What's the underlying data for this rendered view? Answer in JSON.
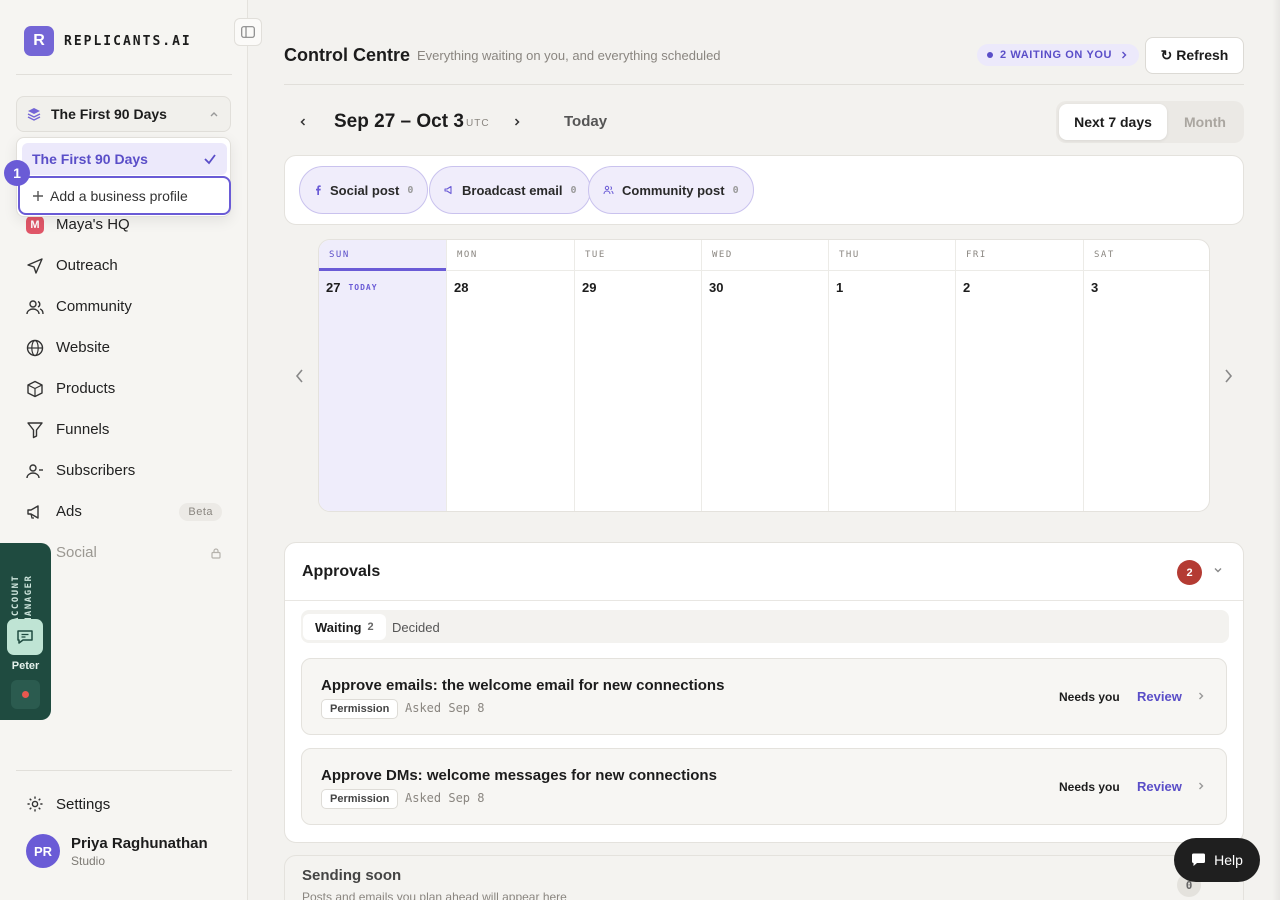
{
  "brand": {
    "initial": "R",
    "name": "REPLICANTS.AI"
  },
  "business_profile": {
    "current": "The First 90 Days",
    "menu_items": [
      "The First 90 Days"
    ],
    "add_label": "Add a business profile",
    "step_marker": "1"
  },
  "sidebar": {
    "items": [
      {
        "label": "Maya's HQ",
        "badge": "M"
      },
      {
        "label": "Outreach"
      },
      {
        "label": "Community"
      },
      {
        "label": "Website"
      },
      {
        "label": "Products"
      },
      {
        "label": "Funnels"
      },
      {
        "label": "Subscribers"
      },
      {
        "label": "Ads",
        "tag": "Beta"
      },
      {
        "label": "Social",
        "locked": true
      }
    ],
    "settings_label": "Settings"
  },
  "account_manager": {
    "label": "ACCOUNT MANAGER",
    "name": "Peter"
  },
  "user": {
    "initials": "PR",
    "name": "Priya Raghunathan",
    "plan": "Studio"
  },
  "header": {
    "title": "Control Centre",
    "subtitle": "Everything waiting on you, and everything scheduled",
    "waiting_pill": "2 WAITING ON YOU",
    "refresh_label": "↻ Refresh"
  },
  "calendar": {
    "range": "Sep 27 – Oct 3",
    "timezone": "UTC",
    "today_label": "Today",
    "view_options": [
      "Next 7 days",
      "Month"
    ],
    "active_view": "Next 7 days",
    "filters": [
      {
        "label": "Social post",
        "count": "0",
        "icon": "facebook-icon"
      },
      {
        "label": "Broadcast email",
        "count": "0",
        "icon": "megaphone-icon"
      },
      {
        "label": "Community post",
        "count": "0",
        "icon": "people-icon"
      }
    ],
    "days": [
      {
        "dow": "SUN",
        "date": "27",
        "tag": "TODAY"
      },
      {
        "dow": "MON",
        "date": "28"
      },
      {
        "dow": "TUE",
        "date": "29"
      },
      {
        "dow": "WED",
        "date": "30"
      },
      {
        "dow": "THU",
        "date": "1"
      },
      {
        "dow": "FRI",
        "date": "2"
      },
      {
        "dow": "SAT",
        "date": "3"
      }
    ]
  },
  "approvals": {
    "title": "Approvals",
    "count": "2",
    "tabs": {
      "waiting": "Waiting",
      "waiting_count": "2",
      "decided": "Decided"
    },
    "requests": [
      {
        "title": "Approve emails: the welcome email for new connections",
        "badge": "Permission",
        "asked": "Asked Sep 8",
        "status": "Needs you",
        "action": "Review"
      },
      {
        "title": "Approve DMs: welcome messages for new connections",
        "badge": "Permission",
        "asked": "Asked Sep 8",
        "status": "Needs you",
        "action": "Review"
      }
    ]
  },
  "sending_soon": {
    "title": "Sending soon",
    "subtitle": "Posts and emails you plan ahead will appear here",
    "count": "0"
  },
  "help_label": "Help",
  "colors": {
    "accent": "#6a5bd6",
    "account_manager_bg": "#1f4b40",
    "alert": "#b43b33"
  }
}
